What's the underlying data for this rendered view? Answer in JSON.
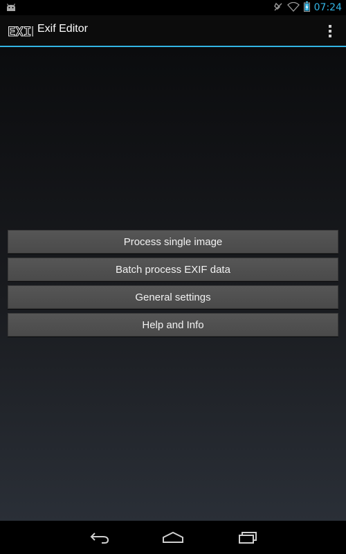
{
  "status_bar": {
    "time": "07:24",
    "icons": [
      "android-notification-icon",
      "mute-icon",
      "wifi-icon",
      "battery-charging-icon"
    ],
    "accent_color": "#33b5e5"
  },
  "action_bar": {
    "logo_text": "EXIF",
    "title": "Exif Editor",
    "overflow_icon": "overflow-menu-icon",
    "divider_color": "#33b5e5"
  },
  "menu": {
    "buttons": [
      {
        "label": "Process single image"
      },
      {
        "label": "Batch process EXIF data"
      },
      {
        "label": "General settings"
      },
      {
        "label": "Help and Info"
      }
    ]
  },
  "nav_bar": {
    "icons": [
      "back-icon",
      "home-icon",
      "recent-apps-icon"
    ]
  }
}
